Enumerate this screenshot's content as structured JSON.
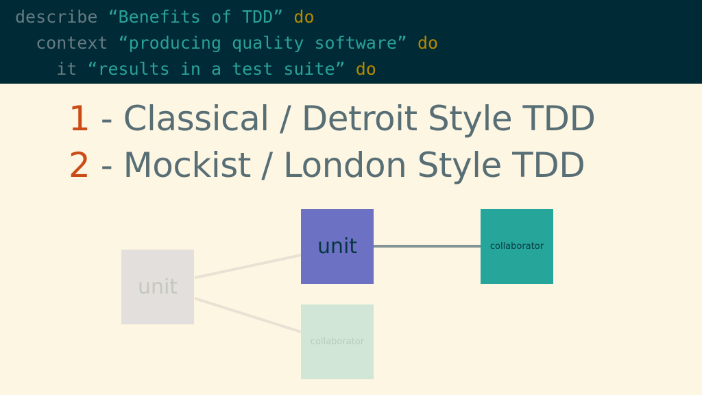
{
  "code": {
    "line1": {
      "keyword": "describe ",
      "string": "“Benefits of TDD”",
      "do": " do"
    },
    "line2": {
      "keyword": "  context ",
      "string": "“producing quality software”",
      "do": " do"
    },
    "line3": {
      "keyword": "    it ",
      "string": "“results in a test suite”",
      "do": " do"
    }
  },
  "headlines": [
    {
      "number": "1",
      "text": " - Classical / Detroit Style TDD"
    },
    {
      "number": "2",
      "text": " - Mockist / London Style TDD"
    }
  ],
  "diagram": {
    "unit_label": "unit",
    "collaborator_label": "collaborator",
    "ghost_unit_label": "unit",
    "ghost_collaborator_label": "collaborator"
  },
  "colors": {
    "background": "#fdf6e3",
    "code_background": "#002b36",
    "unit": "#6c71c4",
    "collaborator": "#26a69a",
    "accent_number": "#cb4b16"
  }
}
